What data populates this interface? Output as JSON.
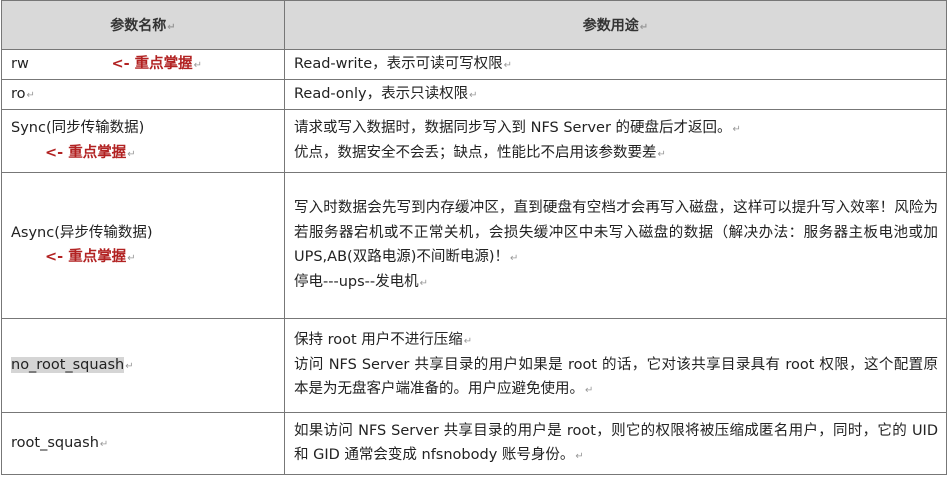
{
  "header": {
    "col1": "参数名称",
    "col2": "参数用途"
  },
  "rows": [
    {
      "name": "rw",
      "note": "<- 重点掌握",
      "desc": [
        "Read-write，表示可读可写权限"
      ]
    },
    {
      "name": "ro",
      "desc": [
        "Read-only，表示只读权限"
      ]
    },
    {
      "name": "Sync(同步传输数据)",
      "note": "<- 重点掌握",
      "desc": [
        "请求或写入数据时，数据同步写入到 NFS Server 的硬盘后才返回。",
        "优点，数据安全不会丢；缺点，性能比不启用该参数要差"
      ]
    },
    {
      "name": "Async(异步传输数据)",
      "note": "<- 重点掌握",
      "desc": [
        "写入时数据会先写到内存缓冲区，直到硬盘有空档才会再写入磁盘，这样可以提升写入效率！风险为若服务器宕机或不正常关机，会损失缓冲区中未写入磁盘的数据（解决办法：服务器主板电池或加 UPS,AB(双路电源)不间断电源)！",
        "停电---ups--发电机"
      ]
    },
    {
      "name": "no_root_squash",
      "desc": [
        "保持 root 用户不进行压缩",
        "访问 NFS Server 共享目录的用户如果是 root 的话，它对该共享目录具有 root 权限，这个配置原本是为无盘客户端准备的。用户应避免使用。"
      ]
    },
    {
      "name": "root_squash",
      "desc": [
        "如果访问 NFS Server 共享目录的用户是 root，则它的权限将被压缩成匿名用户，同时，它的 UID 和 GID 通常会变成 nfsnobody 账号身份。"
      ]
    }
  ]
}
